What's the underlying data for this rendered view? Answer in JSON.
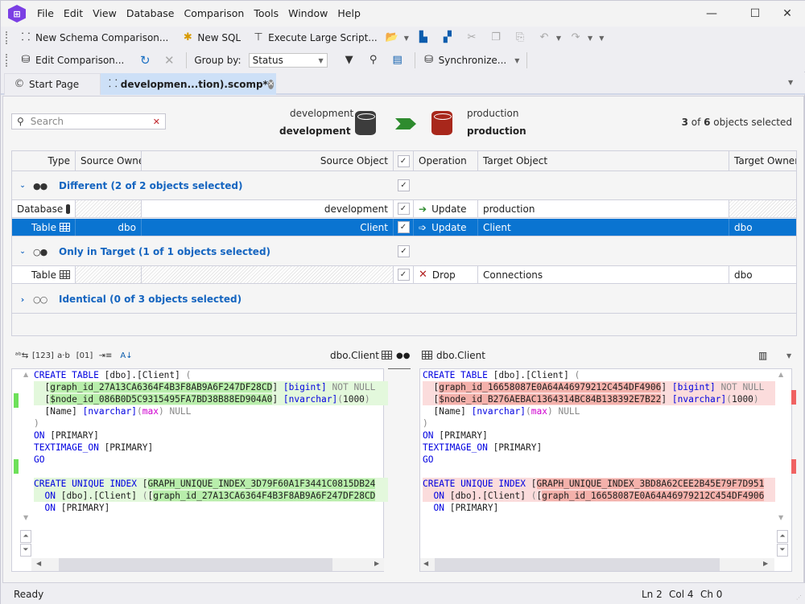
{
  "menu": [
    "File",
    "Edit",
    "View",
    "Database",
    "Comparison",
    "Tools",
    "Window",
    "Help"
  ],
  "window_controls": {
    "minimize": "—",
    "maximize": "☐",
    "close": "✕"
  },
  "toolbar1": {
    "new_schema_comparison": "New Schema Comparison...",
    "new_sql": "New SQL",
    "execute_large_script": "Execute Large Script..."
  },
  "toolbar2": {
    "edit_comparison": "Edit Comparison...",
    "group_by_label": "Group by:",
    "group_by_value": "Status",
    "synchronize": "Synchronize..."
  },
  "tabs": [
    {
      "label": "Start Page",
      "active": false
    },
    {
      "label": "developmen...tion).scomp*",
      "active": true
    }
  ],
  "comparison": {
    "search_placeholder": "Search",
    "source": {
      "server": "development",
      "database": "development",
      "color": "#3c3c3c"
    },
    "target": {
      "server": "production",
      "database": "production",
      "color": "#a8271b"
    },
    "selected_count": "3",
    "total_count": "6",
    "selected_suffix": " objects selected",
    "of_label": " of "
  },
  "grid": {
    "headers": {
      "type": "Type",
      "source_owner": "Source Owner",
      "source_object": "Source Object",
      "operation": "Operation",
      "target_object": "Target Object",
      "target_owner": "Target Owner"
    },
    "groups": [
      {
        "label": "Different (2 of 2 objects selected)",
        "icon": "●●",
        "expanded": true,
        "rows": [
          {
            "type": "Database",
            "source_owner": "",
            "source_object": "development",
            "checked": true,
            "operation": "Update",
            "target_object": "production",
            "target_owner": "",
            "selected": false
          },
          {
            "type": "Table",
            "source_owner": "dbo",
            "source_object": "Client",
            "checked": true,
            "operation": "Update",
            "target_object": "Client",
            "target_owner": "dbo",
            "selected": true
          }
        ]
      },
      {
        "label": "Only in Target (1 of 1 objects selected)",
        "icon": "○●",
        "expanded": true,
        "rows": [
          {
            "type": "Table",
            "source_owner": "",
            "source_object": "",
            "checked": true,
            "operation": "Drop",
            "target_object": "Connections",
            "target_owner": "dbo",
            "selected": false
          }
        ]
      },
      {
        "label": "Identical (0 of 3 objects selected)",
        "icon": "○○",
        "expanded": false,
        "rows": []
      }
    ]
  },
  "diff": {
    "left_title": "dbo.Client",
    "right_title": "dbo.Client",
    "left_lines": [
      "CREATE TABLE [dbo].[Client] (",
      "  [graph_id_27A13CA6364F4B3F8AB9A6F247DF28CD] [bigint] NOT NULL",
      "  [$node_id_086B0D5C9315495FA7BD38B88ED904A0] [nvarchar](1000)",
      "  [Name] [nvarchar](max) NULL",
      ")",
      "ON [PRIMARY]",
      "TEXTIMAGE_ON [PRIMARY]",
      "GO",
      "",
      "CREATE UNIQUE INDEX [GRAPH_UNIQUE_INDEX_3D79F60A1F3441C0815DB24",
      "  ON [dbo].[Client] ([graph_id_27A13CA6364F4B3F8AB9A6F247DF28CD",
      "  ON [PRIMARY]"
    ],
    "right_lines": [
      "CREATE TABLE [dbo].[Client] (",
      "  [graph_id_16658087E0A64A46979212C454DF4906] [bigint] NOT NULL",
      "  [$node_id_B276AEBAC1364314BC84B138392E7B22] [nvarchar](1000)",
      "  [Name] [nvarchar](max) NULL",
      ")",
      "ON [PRIMARY]",
      "TEXTIMAGE_ON [PRIMARY]",
      "GO",
      "",
      "CREATE UNIQUE INDEX [GRAPH_UNIQUE_INDEX_3BD8A62CEE2B45E79F7D951",
      "  ON [dbo].[Client] ([graph_id_16658087E0A64A46979212C454DF4906",
      "  ON [PRIMARY]"
    ]
  },
  "status": {
    "text": "Ready",
    "ln": "Ln 2",
    "col": "Col 4",
    "ch": "Ch 0"
  }
}
